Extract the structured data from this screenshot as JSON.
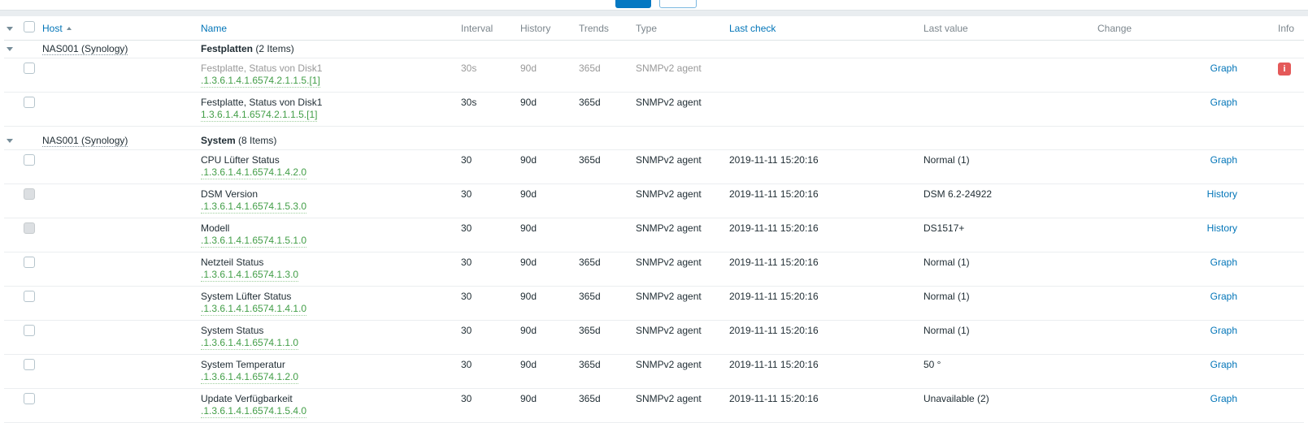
{
  "colors": {
    "link_blue": "#0275b8",
    "key_green": "#429e47",
    "error_red": "#e45959",
    "disabled_text": "#999999",
    "header_muted": "#7c868d"
  },
  "filter_bar": {
    "note": "two buttons cropped at top edge",
    "apply_button_color": "#0478c2",
    "reset_button_border": "#79b7e0"
  },
  "table": {
    "sort": {
      "column": "Host",
      "direction": "ascending"
    },
    "columns": [
      {
        "label": "Host",
        "sortable": true
      },
      {
        "label": "Name",
        "sortable": true
      },
      {
        "label": "Interval",
        "sortable": false
      },
      {
        "label": "History",
        "sortable": false
      },
      {
        "label": "Trends",
        "sortable": false
      },
      {
        "label": "Type",
        "sortable": false
      },
      {
        "label": "Last check",
        "sortable": true
      },
      {
        "label": "Last value",
        "sortable": false
      },
      {
        "label": "Change",
        "sortable": false
      },
      {
        "label": "Info",
        "sortable": false
      }
    ],
    "groups": [
      {
        "host": "NAS001 (Synology)",
        "application": "Festplatten",
        "count": "(2 Items)",
        "items": [
          {
            "name": "Festplatte, Status von Disk1",
            "key": ".1.3.6.1.4.1.6574.2.1.1.5.[1]",
            "interval": "30s",
            "history": "90d",
            "trends": "365d",
            "type": "SNMPv2 agent",
            "last_check": "",
            "last_value": "",
            "change": "",
            "action": "Graph",
            "info": "i",
            "disabled": true,
            "checkbox_disabled": false
          },
          {
            "name": "Festplatte, Status von Disk1",
            "key": "1.3.6.1.4.1.6574.2.1.1.5.[1]",
            "interval": "30s",
            "history": "90d",
            "trends": "365d",
            "type": "SNMPv2 agent",
            "last_check": "",
            "last_value": "",
            "change": "",
            "action": "Graph",
            "info": "",
            "disabled": false,
            "checkbox_disabled": false
          }
        ]
      },
      {
        "host": "NAS001 (Synology)",
        "application": "System",
        "count": "(8 Items)",
        "items": [
          {
            "name": "CPU Lüfter Status",
            "key": ".1.3.6.1.4.1.6574.1.4.2.0",
            "interval": "30",
            "history": "90d",
            "trends": "365d",
            "type": "SNMPv2 agent",
            "last_check": "2019-11-11 15:20:16",
            "last_value": "Normal (1)",
            "change": "",
            "action": "Graph",
            "info": "",
            "disabled": false,
            "checkbox_disabled": false
          },
          {
            "name": "DSM Version",
            "key": ".1.3.6.1.4.1.6574.1.5.3.0",
            "interval": "30",
            "history": "90d",
            "trends": "",
            "type": "SNMPv2 agent",
            "last_check": "2019-11-11 15:20:16",
            "last_value": "DSM 6.2-24922",
            "change": "",
            "action": "History",
            "info": "",
            "disabled": false,
            "checkbox_disabled": true
          },
          {
            "name": "Modell",
            "key": ".1.3.6.1.4.1.6574.1.5.1.0",
            "interval": "30",
            "history": "90d",
            "trends": "",
            "type": "SNMPv2 agent",
            "last_check": "2019-11-11 15:20:16",
            "last_value": "DS1517+",
            "change": "",
            "action": "History",
            "info": "",
            "disabled": false,
            "checkbox_disabled": true
          },
          {
            "name": "Netzteil Status",
            "key": ".1.3.6.1.4.1.6574.1.3.0",
            "interval": "30",
            "history": "90d",
            "trends": "365d",
            "type": "SNMPv2 agent",
            "last_check": "2019-11-11 15:20:16",
            "last_value": "Normal (1)",
            "change": "",
            "action": "Graph",
            "info": "",
            "disabled": false,
            "checkbox_disabled": false
          },
          {
            "name": "System Lüfter Status",
            "key": ".1.3.6.1.4.1.6574.1.4.1.0",
            "interval": "30",
            "history": "90d",
            "trends": "365d",
            "type": "SNMPv2 agent",
            "last_check": "2019-11-11 15:20:16",
            "last_value": "Normal (1)",
            "change": "",
            "action": "Graph",
            "info": "",
            "disabled": false,
            "checkbox_disabled": false
          },
          {
            "name": "System Status",
            "key": ".1.3.6.1.4.1.6574.1.1.0",
            "interval": "30",
            "history": "90d",
            "trends": "365d",
            "type": "SNMPv2 agent",
            "last_check": "2019-11-11 15:20:16",
            "last_value": "Normal (1)",
            "change": "",
            "action": "Graph",
            "info": "",
            "disabled": false,
            "checkbox_disabled": false
          },
          {
            "name": "System Temperatur",
            "key": ".1.3.6.1.4.1.6574.1.2.0",
            "interval": "30",
            "history": "90d",
            "trends": "365d",
            "type": "SNMPv2 agent",
            "last_check": "2019-11-11 15:20:16",
            "last_value": "50 °",
            "change": "",
            "action": "Graph",
            "info": "",
            "disabled": false,
            "checkbox_disabled": false
          },
          {
            "name": "Update Verfügbarkeit",
            "key": ".1.3.6.1.4.1.6574.1.5.4.0",
            "interval": "30",
            "history": "90d",
            "trends": "365d",
            "type": "SNMPv2 agent",
            "last_check": "2019-11-11 15:20:16",
            "last_value": "Unavailable (2)",
            "change": "",
            "action": "Graph",
            "info": "",
            "disabled": false,
            "checkbox_disabled": false
          }
        ]
      }
    ]
  }
}
